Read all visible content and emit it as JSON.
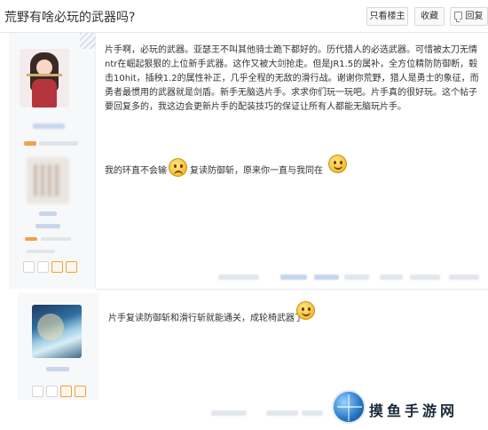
{
  "header": {
    "title": "荒野有啥必玩的武器吗?",
    "only_op_label": "只看楼主",
    "favorite_label": "收藏",
    "reply_label": "回复"
  },
  "post1": {
    "paragraph": "片手啊，必玩的武器。亚瑟王不叫其他骑士跪下都好的。历代猎人的必选武器。可惜被太刀无情ntr在崛起狠狠的上位新手武器。这作又被大剑抢走。但是JR1.5的属补，全方位精防防御断，毂击10hit，插秧1.2的属性补正，几乎全程的无敌的滑行战。谢谢你荒野，猎人是勇士的象征，而勇者最惯用的武器就是剑盾。新手无脑选片手。求求你们玩一玩吧。片手真的很好玩。这个帖子要回复多的，我这边会更新片手的配装技巧的保证让所有人都能无脑玩片手。",
    "line2_a": "我的环直不会输",
    "line2_b": "复读防御斩，原来你一直与我同在"
  },
  "post2": {
    "text": "片手复读防御斩和滑行斩就能通关，成轮椅武器了"
  },
  "watermark": {
    "text": "摸鱼手游网"
  },
  "icons": {
    "reply": "reply-icon",
    "emoji_smile": "smile-emoji-icon",
    "emoji_sad": "sad-emoji-icon",
    "watermark_logo": "globe-logo-icon"
  }
}
